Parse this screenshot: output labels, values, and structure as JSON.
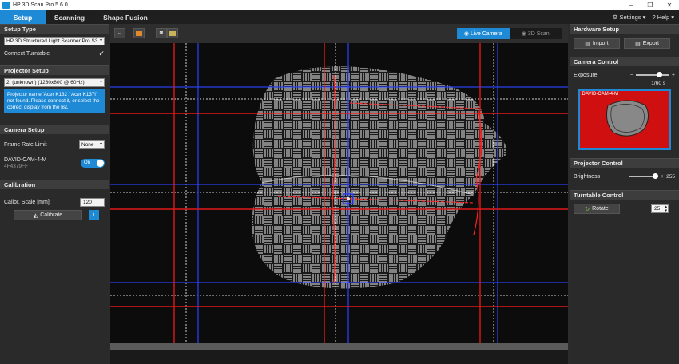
{
  "window": {
    "title": "HP 3D Scan Pro 5.6.0"
  },
  "tabs": [
    {
      "label": "Setup",
      "active": true
    },
    {
      "label": "Scanning",
      "active": false
    },
    {
      "label": "Shape Fusion",
      "active": false
    }
  ],
  "top_links": {
    "settings": "Settings",
    "help": "Help"
  },
  "left": {
    "setup_type": {
      "header": "Setup Type",
      "scanner": "HP 3D Structured Light Scanner Pro S3",
      "connect_turntable": "Connect Turntable",
      "turntable_checked": true
    },
    "projector_setup": {
      "header": "Projector Setup",
      "display": "2: (unknown) (1280x800 @ 60Hz)",
      "info": "Projector name 'Acer K132 / Acer K137i' not found. Please connect it, or select the correct display from the list."
    },
    "camera_setup": {
      "header": "Camera Setup",
      "frame_rate_label": "Frame Rate Limit",
      "frame_rate_value": "None",
      "camera_name": "DAVID-CAM-4-M",
      "camera_id": "4F4379FF",
      "toggle_label": "On"
    },
    "calibration": {
      "header": "Calibration",
      "scale_label": "Calibr. Scale [mm]:",
      "scale_value": "120",
      "calibrate_label": "Calibrate"
    }
  },
  "viewport": {
    "live_camera": "Live Camera",
    "scan_3d": "3D Scan"
  },
  "right": {
    "hardware_setup": {
      "header": "Hardware Setup",
      "import_label": "Import",
      "export_label": "Export"
    },
    "camera_control": {
      "header": "Camera Control",
      "exposure_label": "Exposure",
      "exposure_value": "1/60 s",
      "exposure_level": 0.75,
      "preview_label": "DAVID-CAM-4-M"
    },
    "projector_control": {
      "header": "Projector Control",
      "brightness_label": "Brightness",
      "brightness_value": "255",
      "brightness_level": 1.0
    },
    "turntable_control": {
      "header": "Turntable Control",
      "rotate_label": "Rotate",
      "rotate_value": "25"
    }
  },
  "colors": {
    "accent": "#1e8ad6",
    "guide_red": "#e01818",
    "guide_blue": "#2a3ff0",
    "preview_bg": "#d01010"
  }
}
